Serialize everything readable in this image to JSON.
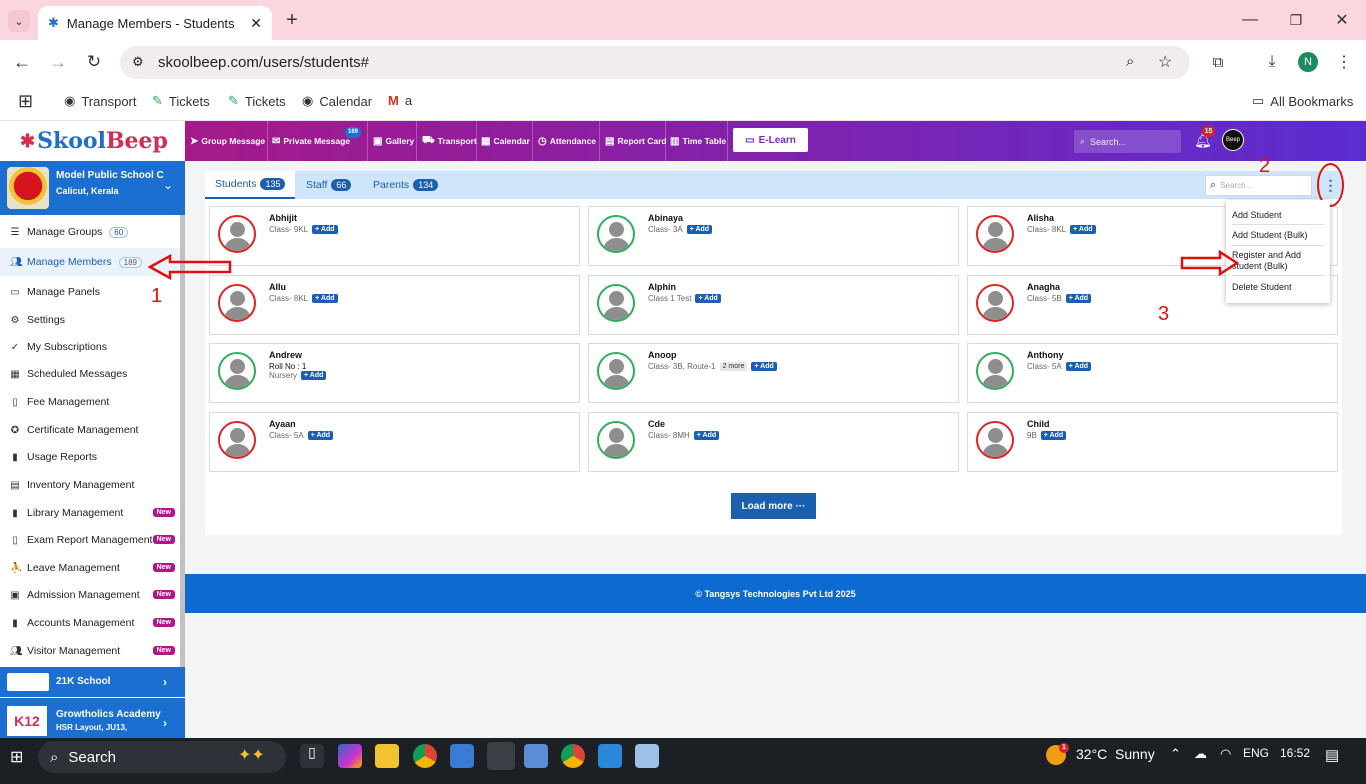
{
  "browser": {
    "tab_title": "Manage Members - Students",
    "url": "skoolbeep.com/users/students#",
    "bookmarks": [
      "Transport",
      "Tickets",
      "Tickets",
      "Calendar",
      "a"
    ],
    "all_bookmarks": "All Bookmarks",
    "profile_initial": "N"
  },
  "app": {
    "logo_a": "Skool",
    "logo_b": "Beep",
    "nav": [
      "Group Message",
      "Private Message",
      "Gallery",
      "Transport",
      "Calendar",
      "Attendance",
      "Report Card",
      "Time Table"
    ],
    "private_badge": "169",
    "elearn": "E-Learn",
    "search_placeholder": "Search...",
    "notif_count": "15"
  },
  "sidebar": {
    "school_name": "Model Public School C",
    "school_location": "Calicut, Kerala",
    "items": [
      {
        "label": "Manage Groups",
        "count": "60"
      },
      {
        "label": "Manage Members",
        "count": "189"
      },
      {
        "label": "Manage Panels"
      },
      {
        "label": "Settings"
      },
      {
        "label": "My Subscriptions"
      },
      {
        "label": "Scheduled Messages"
      },
      {
        "label": "Fee Management"
      },
      {
        "label": "Certificate Management"
      },
      {
        "label": "Usage Reports"
      },
      {
        "label": "Inventory Management"
      },
      {
        "label": "Library Management",
        "new": "New"
      },
      {
        "label": "Exam Report Management",
        "new": "New"
      },
      {
        "label": "Leave Management",
        "new": "New"
      },
      {
        "label": "Admission Management",
        "new": "New"
      },
      {
        "label": "Accounts Management",
        "new": "New"
      },
      {
        "label": "Visitor Management",
        "new": "New"
      }
    ],
    "other_schools": [
      {
        "name": "21K School"
      },
      {
        "name": "Growtholics Academy",
        "location": "HSR Layout, JU13,"
      }
    ]
  },
  "tabs": [
    {
      "label": "Students",
      "count": "135"
    },
    {
      "label": "Staff",
      "count": "66"
    },
    {
      "label": "Parents",
      "count": "134"
    }
  ],
  "panel_search_placeholder": "Search...",
  "add_label": "+ Add",
  "students": [
    {
      "name": "Abhijit",
      "line1": "Class- 9KL",
      "status": "red"
    },
    {
      "name": "Abinaya",
      "line1": "Class- 3A",
      "status": "green"
    },
    {
      "name": "Alisha",
      "line1": "Class- 8KL",
      "status": "red"
    },
    {
      "name": "Allu",
      "line1": "Class- 8KL",
      "status": "red"
    },
    {
      "name": "Alphin",
      "line1": "Class 1 Test",
      "status": "green"
    },
    {
      "name": "Anagha",
      "line1": "Class- 5B",
      "status": "red"
    },
    {
      "name": "Andrew",
      "roll": "Roll No : 1",
      "line1": "Nursery",
      "status": "green"
    },
    {
      "name": "Anoop",
      "line1": "Class- 3B, Route-1",
      "more": "2 more",
      "status": "green"
    },
    {
      "name": "Anthony",
      "line1": "Class- 5A",
      "status": "green"
    },
    {
      "name": "Ayaan",
      "line1": "Class- 5A",
      "status": "red"
    },
    {
      "name": "Cde",
      "line1": "Class- 8MH",
      "status": "green"
    },
    {
      "name": "Child",
      "line1": "9B",
      "status": "red"
    }
  ],
  "load_more": "Load more ···",
  "footer": "© Tangsys Technologies Pvt Ltd 2025",
  "dropdown": [
    "Add Student",
    "Add Student (Bulk)",
    "Register and Add student (Bulk)",
    "Delete Student"
  ],
  "annotations": [
    "1",
    "2",
    "3"
  ],
  "taskbar": {
    "search": "Search",
    "temp": "32°C",
    "weather": "Sunny",
    "lang": "ENG",
    "time": "16:52",
    "weather_badge": "1"
  }
}
